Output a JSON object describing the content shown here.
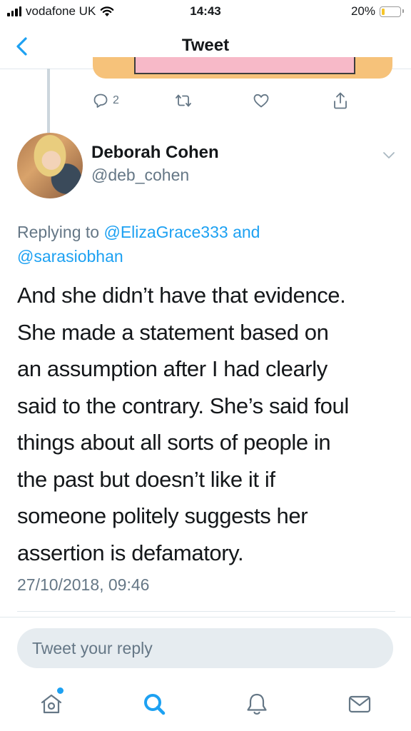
{
  "status_bar": {
    "carrier": "vodafone UK",
    "time": "14:43",
    "battery_percent": "20%",
    "battery_level": 0.2,
    "battery_color": "#f5c52a",
    "signal_icon": "signal-bars-icon",
    "wifi_icon": "wifi-icon"
  },
  "nav": {
    "title": "Tweet",
    "back_icon": "chevron-left-icon"
  },
  "previous_tweet": {
    "reply_count": "2",
    "actions": [
      "reply-icon",
      "retweet-icon",
      "like-icon",
      "share-icon"
    ]
  },
  "tweet": {
    "author_name": "Deborah Cohen",
    "author_handle": "@deb_cohen",
    "replying_prefix": "Replying to",
    "replying_user1": "@ElizaGrace333",
    "replying_and": "and",
    "replying_user2": "@sarasiobhan",
    "text_lines": [
      "And she didn’t have that evidence.",
      "She made a statement based on",
      "an assumption after I had clearly",
      "said to the contrary. She’s said foul",
      "things about all sorts of people in",
      "the past but doesn’t like it if",
      "someone politely suggests her",
      "assertion is defamatory."
    ],
    "timestamp": "27/10/2018, 09:46"
  },
  "reply_box": {
    "placeholder": "Tweet your reply"
  },
  "tab_bar": {
    "items": [
      "home-icon",
      "search-icon",
      "notifications-icon",
      "messages-icon"
    ],
    "active_item": "search-icon"
  },
  "colors": {
    "accent": "#1da1f2",
    "secondary_text": "#657786",
    "reply_box_bg": "#e6ecf0"
  }
}
